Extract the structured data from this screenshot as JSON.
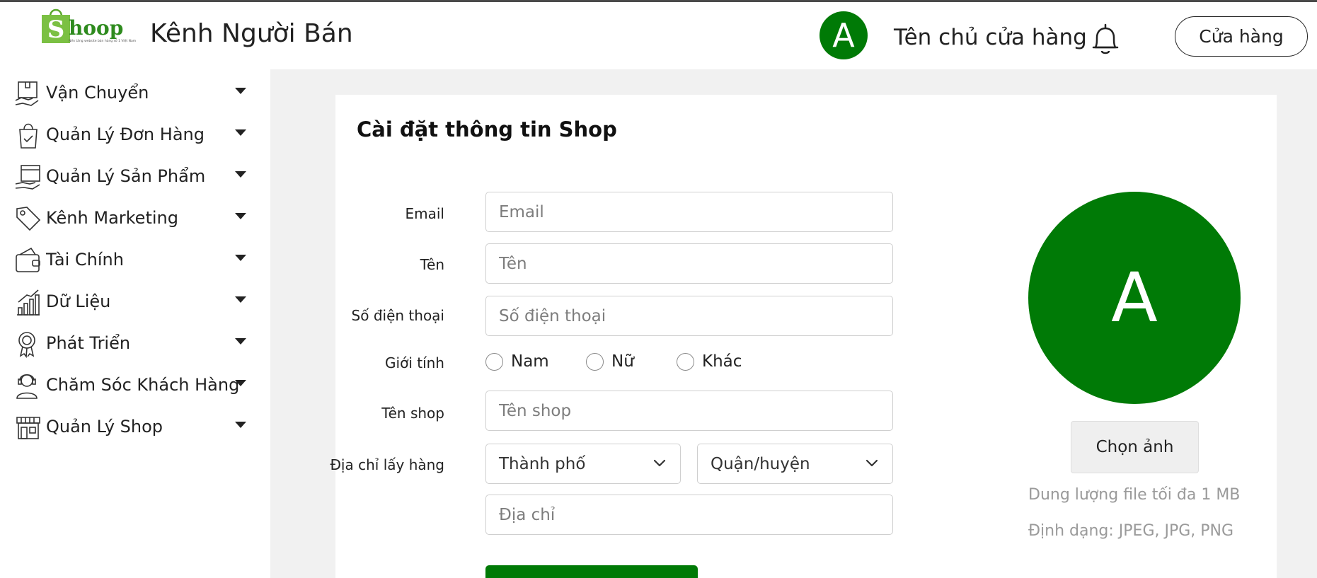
{
  "header": {
    "logo_text": "Shoop",
    "logo_tagline": "Nền tảng website bán hàng số 1 Việt Nam",
    "title": "Kênh Người Bán",
    "avatar_letter": "A",
    "owner_name": "Tên chủ cửa hàng",
    "bell_icon": "bell-icon",
    "store_button": "Cửa hàng"
  },
  "sidebar": {
    "items": [
      {
        "label": "Vận Chuyển",
        "icon": "shipping-icon"
      },
      {
        "label": "Quản Lý Đơn Hàng",
        "icon": "shopping-bag-icon"
      },
      {
        "label": "Quản Lý Sản Phẩm",
        "icon": "product-box-icon"
      },
      {
        "label": "Kênh Marketing",
        "icon": "tag-icon"
      },
      {
        "label": "Tài Chính",
        "icon": "wallet-icon"
      },
      {
        "label": "Dữ Liệu",
        "icon": "chart-icon"
      },
      {
        "label": "Phát Triển",
        "icon": "badge-icon"
      },
      {
        "label": "Chăm Sóc Khách Hàng",
        "icon": "support-agent-icon"
      },
      {
        "label": "Quản Lý Shop",
        "icon": "storefront-icon"
      }
    ]
  },
  "form": {
    "title": "Cài đặt thông tin Shop",
    "email_label": "Email",
    "email_placeholder": "Email",
    "name_label": "Tên",
    "name_placeholder": "Tên",
    "phone_label": "Số điện thoại",
    "phone_placeholder": "Số điện thoại",
    "gender_label": "Giới tính",
    "gender_options": [
      "Nam",
      "Nữ",
      "Khác"
    ],
    "shop_name_label": "Tên shop",
    "shop_name_placeholder": "Tên shop",
    "address_label": "Địa chỉ lấy hàng",
    "city_select": "Thành phố",
    "district_select": "Quận/huyện",
    "address_placeholder": "Địa chỉ"
  },
  "profile": {
    "avatar_letter": "A",
    "choose_button": "Chọn ảnh",
    "hint_size": "Dung lượng file tối đa 1 MB",
    "hint_format": "Định dạng: JPEG, JPG, PNG"
  },
  "colors": {
    "brand_green": "#007a06",
    "content_bg": "#f1f1f1"
  }
}
